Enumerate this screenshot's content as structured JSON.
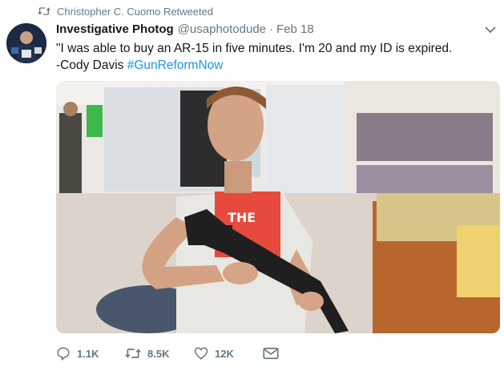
{
  "retweet_banner": {
    "text": "Christopher C. Cuomo Retweeted",
    "icon": "retweet-icon"
  },
  "tweet": {
    "author_name": "Investigative Photog",
    "handle": "@usaphotodude",
    "separator": "·",
    "date": "Feb 18",
    "text_line1": "\"I was able to buy an AR-15 in five minutes. I'm 20 and my ID is expired.",
    "text_line2_prefix": "-Cody Davis ",
    "hashtag": "#GunReformNow",
    "photo_shirt_text": "THE"
  },
  "actions": {
    "reply_count": "1.1K",
    "retweet_count": "8.5K",
    "like_count": "12K"
  },
  "colors": {
    "link": "#1b95e0",
    "muted": "#657786",
    "text": "#14171a"
  }
}
